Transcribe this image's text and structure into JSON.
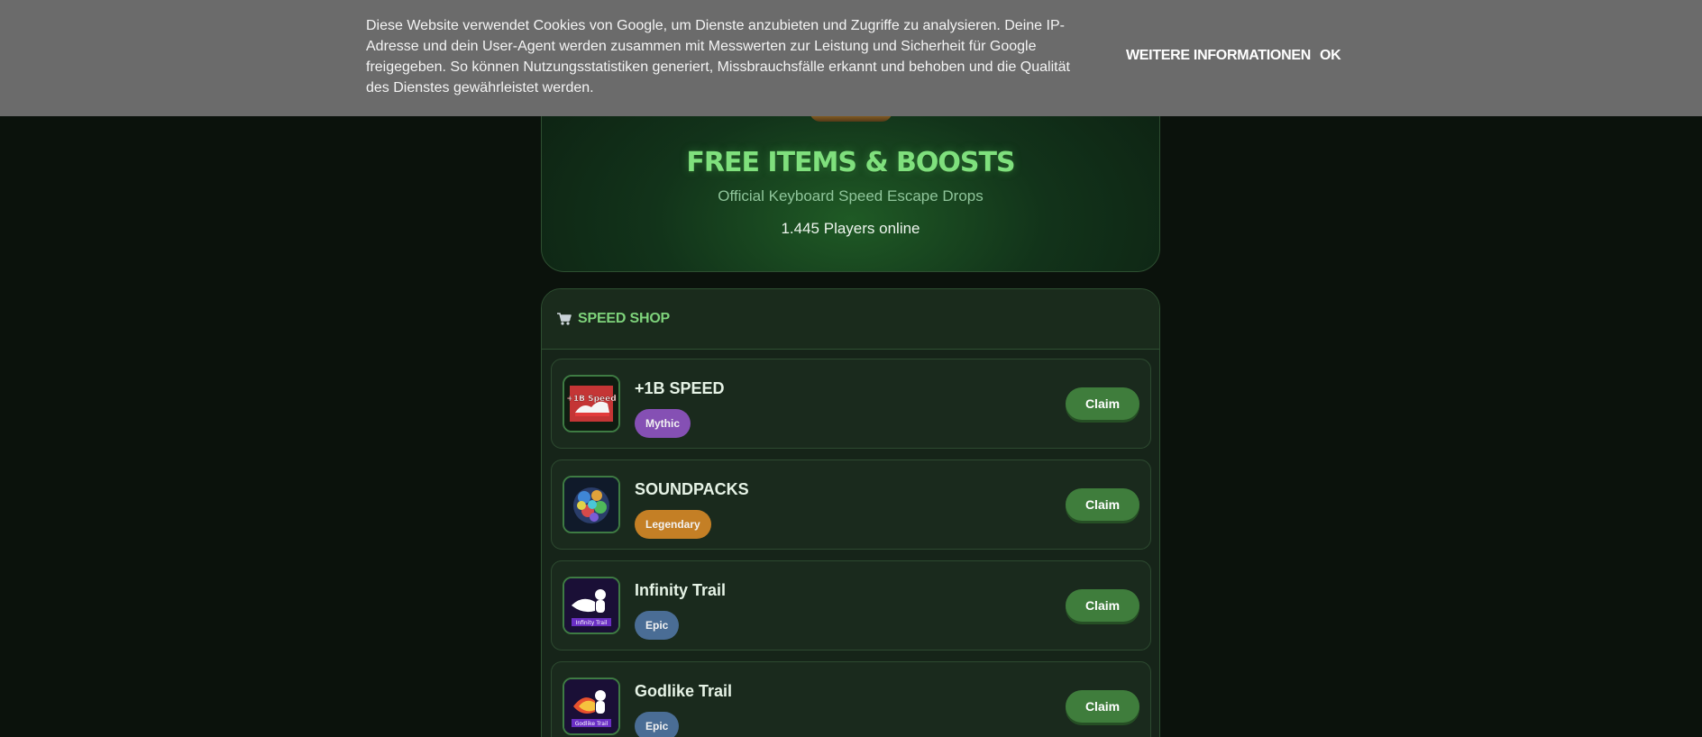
{
  "cookie_banner": {
    "text": "Diese Website verwendet Cookies von Google, um Dienste anzubieten und Zugriffe zu analysieren. Deine IP-Adresse und dein User-Agent werden zusammen mit Messwerten zur Leistung und Sicherheit für Google freigegeben. So können Nutzungsstatistiken generiert, Missbrauchsfälle erkannt und behoben und die Qualität des Dienstes gewährleistet werden.",
    "more_info_label": "WEITERE INFORMATIONEN",
    "ok_label": "OK"
  },
  "hero": {
    "title": "FREE ITEMS & BOOSTS",
    "subtitle": "Official Keyboard Speed Escape Drops",
    "online": "1.445 Players online"
  },
  "shop": {
    "title": "SPEED SHOP",
    "icon": "cart-icon",
    "items": [
      {
        "name": "+1B SPEED",
        "rarity": "Mythic",
        "claim_label": "Claim",
        "thumb_text": "+1B Speed",
        "rarity_color": "#8550b4"
      },
      {
        "name": "SOUNDPACKS",
        "rarity": "Legendary",
        "claim_label": "Claim",
        "rarity_color": "#c47f25"
      },
      {
        "name": "Infinity Trail",
        "rarity": "Epic",
        "claim_label": "Claim",
        "thumb_text": "Infinity Trail",
        "rarity_color": "#4a6d95"
      },
      {
        "name": "Godlike Trail",
        "rarity": "Epic",
        "claim_label": "Claim",
        "thumb_text": "Godlike Trail",
        "rarity_color": "#4a6d95"
      }
    ]
  },
  "colors": {
    "accent_green": "#7fe07d",
    "claim_button": "#3f7d3c",
    "banner_bg": "#6b6b6b",
    "page_bg": "#0b120c"
  }
}
